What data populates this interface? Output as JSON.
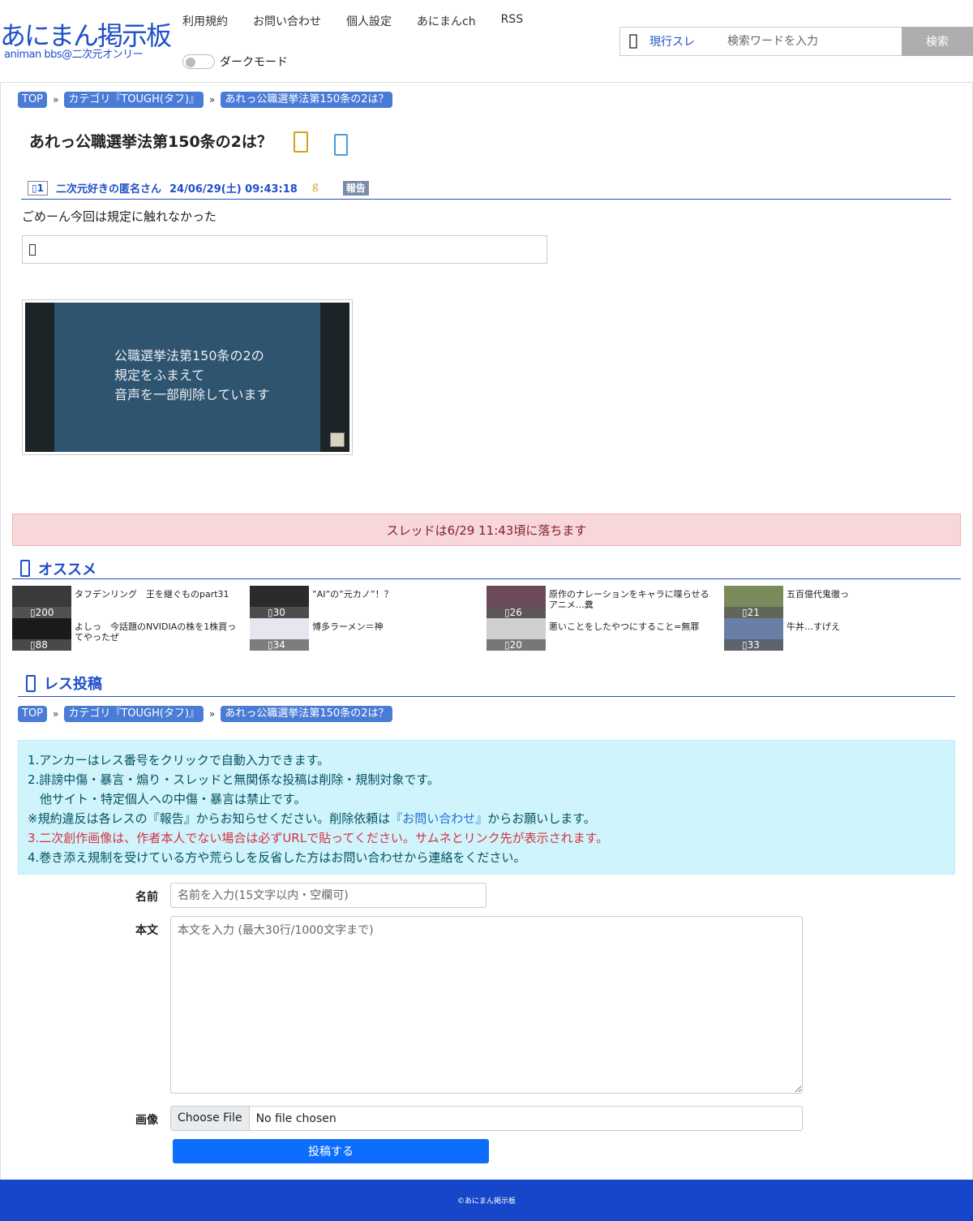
{
  "header": {
    "logo_title": "あにまん掲示板",
    "logo_sub": "animan bbs@二次元オンリー",
    "nav": [
      "利用規約",
      "お問い合わせ",
      "個人設定",
      "あにまんch",
      "RSS"
    ],
    "dark_mode_label": "ダークモード",
    "search": {
      "scope": "現行スレ",
      "placeholder": "検索ワードを入力",
      "button": "検索"
    }
  },
  "breadcrumb": [
    "TOP",
    "カテゴリ『TOUGH(タフ)』",
    "あれっ公職選挙法第150条の2は？"
  ],
  "thread": {
    "title": "あれっ公職選挙法第150条の2は？",
    "post": {
      "number": "1",
      "name": "二次元好きの匿名さん",
      "date": "24/06/29(土) 09:43:18",
      "id_mark": "ｇ",
      "report": "報告",
      "body": "ごめーん今回は規定に触れなかった",
      "image_lines": [
        "公職選挙法第150条の2の",
        "規定をふまえて",
        "音声を一部削除しています"
      ]
    }
  },
  "fall_notice": "スレッドは6/29 11:43頃に落ちます",
  "recommend": {
    "title": "オススメ",
    "items": [
      {
        "title": "タフデンリング　王を継ぐものpart31",
        "count": "200",
        "thumb": "#3a3a3a"
      },
      {
        "title": "”AI”の”元カノ”！？",
        "count": "30",
        "thumb": "#2b2b2b"
      },
      {
        "title": "原作のナレーションをキャラに喋らせるアニメ…糞",
        "count": "26",
        "thumb": "#6b4a5a"
      },
      {
        "title": "五百億代鬼徹っ",
        "count": "21",
        "thumb": "#7a8a5a"
      },
      {
        "title": "よしっ　今話題のNVIDIAの株を1株買ってやったぜ",
        "count": "88",
        "thumb": "#1a1a1a"
      },
      {
        "title": "博多ラーメン＝神",
        "count": "34",
        "thumb": "#e8e4f0"
      },
      {
        "title": "悪いことをしたやつにすること=無罪",
        "count": "20",
        "thumb": "#cfcfcf"
      },
      {
        "title": "牛丼…すげえ",
        "count": "33",
        "thumb": "#6a7fa8"
      }
    ]
  },
  "reply": {
    "title": "レス投稿",
    "rules": {
      "l1": "1.アンカーはレス番号をクリックで自動入力できます。",
      "l2": "2.誹謗中傷・暴言・煽り・スレッドと無関係な投稿は削除・規制対象です。",
      "l3": "　他サイト・特定個人への中傷・暴言は禁止です。",
      "l4a": "※規約違反は各レスの『報告』からお知らせください。削除依頼は",
      "l4link": "『お問い合わせ』",
      "l4b": "からお願いします。",
      "l5": "3.二次創作画像は、作者本人でない場合は必ずURLで貼ってください。サムネとリンク先が表示されます。",
      "l6": "4.巻き添え規制を受けている方や荒らしを反省した方はお問い合わせから連絡をください。"
    },
    "name_label": "名前",
    "name_placeholder": "名前を入力(15文字以内・空欄可)",
    "body_label": "本文",
    "body_placeholder": "本文を入力 (最大30行/1000文字まで)",
    "image_label": "画像",
    "file_button": "Choose File",
    "file_none": "No file chosen",
    "submit": "投稿する"
  },
  "footer": "©あにまん掲示板",
  "colors": {
    "brand": "#1f4fc8",
    "crumb": "#4a7bd6",
    "alert_bg": "#f8d7da",
    "info_bg": "#cff4fc",
    "submit": "#0d6efd",
    "footer": "#1646c9"
  }
}
